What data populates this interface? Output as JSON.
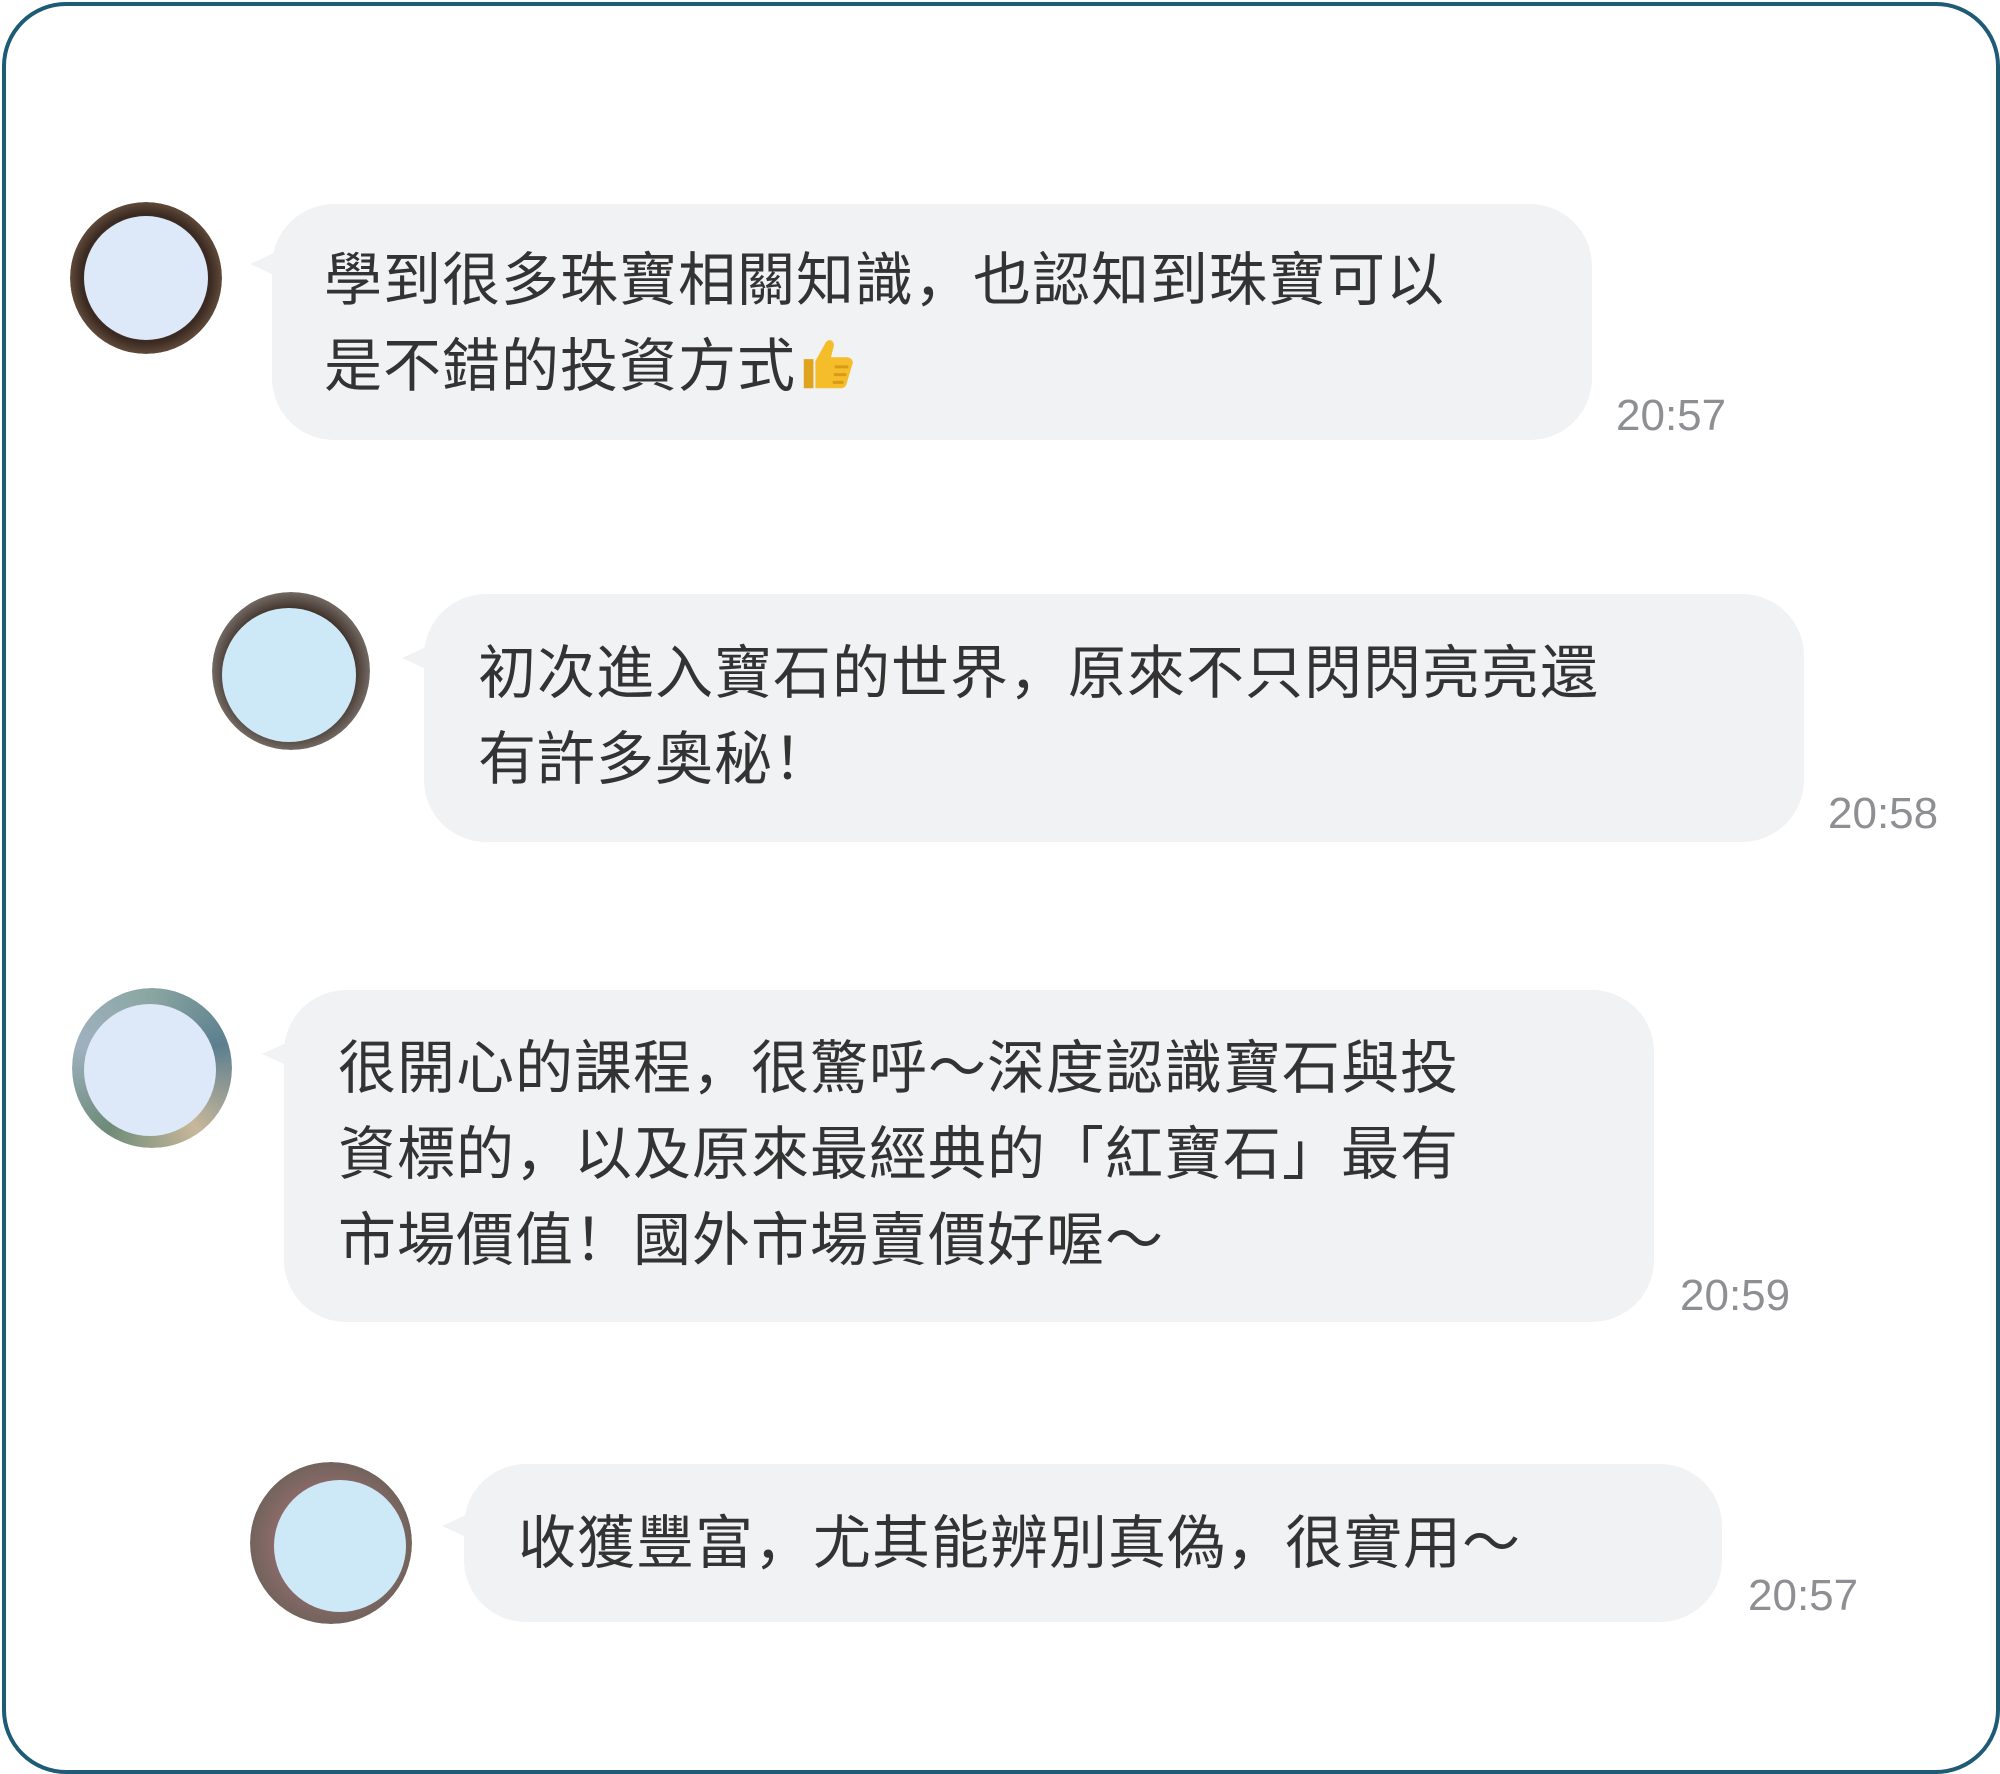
{
  "chat": {
    "messages": [
      {
        "text": "學到很多珠寶相關知識，也認知到珠寶可以\n是不錯的投資方式",
        "emoji": "thumbs-up",
        "time": "20:57"
      },
      {
        "text": "初次進入寶石的世界，原來不只閃閃亮亮還\n有許多奧秘！",
        "time": "20:58"
      },
      {
        "text": "很開心的課程，很驚呼～深度認識寶石與投\n資標的，以及原來最經典的「紅寶石」最有\n市場價值！國外市場賣價好喔～",
        "time": "20:59"
      },
      {
        "text": "收獲豐富，尤其能辨別真偽，很實用～",
        "time": "20:57"
      }
    ]
  },
  "colors": {
    "frame_border": "#1e5b74",
    "bubble_bg": "#f1f2f4",
    "text": "#333333",
    "timestamp": "#8e8f93",
    "avatar_mask_1": "#dde8f8",
    "avatar_mask_2": "#cde9f8"
  },
  "icons": {
    "emoji": "thumbs-up-icon"
  }
}
